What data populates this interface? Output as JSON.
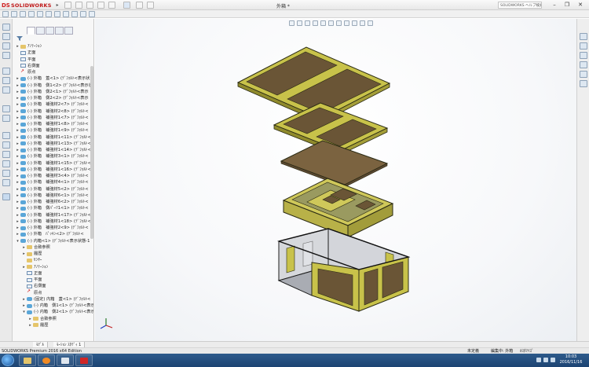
{
  "window": {
    "brand": "SOLIDWORKS",
    "doc_title": "外箱 *",
    "search_text": "SOLIDWORKS ヘルプ検索",
    "min_label": "–",
    "max_label": "❐",
    "close_label": "✕"
  },
  "tree": {
    "rows": [
      {
        "indent": 0,
        "expand": "▸",
        "icon": "folder",
        "label": "ｱﾉﾃｰｼｮﾝ"
      },
      {
        "indent": 0,
        "expand": "",
        "icon": "plane",
        "label": "正面"
      },
      {
        "indent": 0,
        "expand": "",
        "icon": "plane",
        "label": "平面"
      },
      {
        "indent": 0,
        "expand": "",
        "icon": "plane",
        "label": "右側面"
      },
      {
        "indent": 0,
        "expand": "",
        "icon": "origin",
        "label": "原点"
      },
      {
        "indent": 0,
        "expand": "▸",
        "icon": "comp",
        "label": "(-) 外箱　蓋<1> (ﾃﾞﾌｫﾙﾄ<表示状"
      },
      {
        "indent": 0,
        "expand": "▸",
        "icon": "comp",
        "label": "(-) 外箱　側1<2> (ﾃﾞﾌｫﾙﾄ<表示状"
      },
      {
        "indent": 0,
        "expand": "▸",
        "icon": "comp",
        "label": "(-) 外箱　側2<1> (ﾃﾞﾌｫﾙﾄ<表示"
      },
      {
        "indent": 0,
        "expand": "▸",
        "icon": "comp",
        "label": "(-) 外箱　側2<2> (ﾃﾞﾌｫﾙﾄ<表示"
      },
      {
        "indent": 0,
        "expand": "▸",
        "icon": "comp",
        "label": "(-) 外箱　補強材2<7> (ﾃﾞﾌｫﾙﾄ<"
      },
      {
        "indent": 0,
        "expand": "▸",
        "icon": "comp",
        "label": "(-) 外箱　補強材2<8> (ﾃﾞﾌｫﾙﾄ<"
      },
      {
        "indent": 0,
        "expand": "▸",
        "icon": "comp",
        "label": "(-) 外箱　補強材1<7> (ﾃﾞﾌｫﾙﾄ<"
      },
      {
        "indent": 0,
        "expand": "▸",
        "icon": "comp",
        "label": "(-) 外箱　補強材1<8> (ﾃﾞﾌｫﾙﾄ<"
      },
      {
        "indent": 0,
        "expand": "▸",
        "icon": "comp",
        "label": "(-) 外箱　補強材1<9> (ﾃﾞﾌｫﾙﾄ<"
      },
      {
        "indent": 0,
        "expand": "▸",
        "icon": "comp",
        "label": "(-) 外箱　補強材1<11> (ﾃﾞﾌｫﾙﾄ<"
      },
      {
        "indent": 0,
        "expand": "▸",
        "icon": "comp",
        "label": "(-) 外箱　補強材1<13> (ﾃﾞﾌｫﾙﾄ<"
      },
      {
        "indent": 0,
        "expand": "▸",
        "icon": "comp",
        "label": "(-) 外箱　補強材1<14> (ﾃﾞﾌｫﾙﾄ<"
      },
      {
        "indent": 0,
        "expand": "▸",
        "icon": "comp",
        "label": "(-) 外箱　補強材3<1> (ﾃﾞﾌｫﾙﾄ<"
      },
      {
        "indent": 0,
        "expand": "▸",
        "icon": "comp",
        "label": "(-) 外箱　補強材1<15> (ﾃﾞﾌｫﾙﾄ<"
      },
      {
        "indent": 0,
        "expand": "▸",
        "icon": "comp",
        "label": "(-) 外箱　補強材1<16> (ﾃﾞﾌｫﾙﾄ<"
      },
      {
        "indent": 0,
        "expand": "▸",
        "icon": "comp",
        "label": "(-) 外箱　補強材3<4> (ﾃﾞﾌｫﾙﾄ<"
      },
      {
        "indent": 0,
        "expand": "▸",
        "icon": "comp",
        "label": "(-) 外箱　補強材4<1> (ﾃﾞﾌｫﾙﾄ<"
      },
      {
        "indent": 0,
        "expand": "▸",
        "icon": "comp",
        "label": "(-) 外箱　補強材5<2> (ﾃﾞﾌｫﾙﾄ<"
      },
      {
        "indent": 0,
        "expand": "▸",
        "icon": "comp",
        "label": "(-) 外箱　補強材6<1> (ﾃﾞﾌｫﾙﾄ<"
      },
      {
        "indent": 0,
        "expand": "▸",
        "icon": "comp",
        "label": "(-) 外箱　補強材6<2> (ﾃﾞﾌｫﾙﾄ<"
      },
      {
        "indent": 0,
        "expand": "▸",
        "icon": "comp",
        "label": "(-) 外箱　側ﾊﾟｰﾂ1<1> (ﾃﾞﾌｫﾙﾄ<"
      },
      {
        "indent": 0,
        "expand": "▸",
        "icon": "comp",
        "label": "(-) 外箱　補強材1<17> (ﾃﾞﾌｫﾙﾄ<"
      },
      {
        "indent": 0,
        "expand": "▸",
        "icon": "comp",
        "label": "(-) 外箱　補強材1<18> (ﾃﾞﾌｫﾙﾄ<"
      },
      {
        "indent": 0,
        "expand": "▸",
        "icon": "comp",
        "label": "(-) 外箱　補強材2<9> (ﾃﾞﾌｫﾙﾄ<"
      },
      {
        "indent": 0,
        "expand": "▸",
        "icon": "comp",
        "label": "(-) 外箱　ﾊﾟｯｷﾝ<2> (ﾃﾞﾌｫﾙﾄ<"
      },
      {
        "indent": 0,
        "expand": "▾",
        "icon": "comp",
        "label": "(-) 内箱<1> (ﾃﾞﾌｫﾙﾄ<表示状態-1"
      },
      {
        "indent": 1,
        "expand": "▸",
        "icon": "folder",
        "label": "合致参照"
      },
      {
        "indent": 1,
        "expand": "▸",
        "icon": "folder",
        "label": "履歴"
      },
      {
        "indent": 1,
        "expand": "",
        "icon": "folder",
        "label": "ｾﾝｻｰ"
      },
      {
        "indent": 1,
        "expand": "▸",
        "icon": "folder",
        "label": "ｱﾉﾃｰｼｮﾝ"
      },
      {
        "indent": 1,
        "expand": "",
        "icon": "plane",
        "label": "正面"
      },
      {
        "indent": 1,
        "expand": "",
        "icon": "plane",
        "label": "平面"
      },
      {
        "indent": 1,
        "expand": "",
        "icon": "plane",
        "label": "右側面"
      },
      {
        "indent": 1,
        "expand": "",
        "icon": "origin",
        "label": "原点"
      },
      {
        "indent": 1,
        "expand": "▸",
        "icon": "comp",
        "label": "(固定) 内箱　蓋<1> (ﾃﾞﾌｫﾙﾄ<"
      },
      {
        "indent": 1,
        "expand": "▸",
        "icon": "comp",
        "label": "(-) 内箱　側1<1> (ﾃﾞﾌｫﾙﾄ<表示"
      },
      {
        "indent": 1,
        "expand": "▾",
        "icon": "comp",
        "label": "(-) 内箱　側2<1> (ﾃﾞﾌｫﾙﾄ<表示"
      },
      {
        "indent": 2,
        "expand": "▸",
        "icon": "folder",
        "label": "合致参照"
      },
      {
        "indent": 2,
        "expand": "▸",
        "icon": "folder",
        "label": "履歴"
      }
    ]
  },
  "sheet_tabs": [
    "ﾓﾃﾞﾙ",
    "ﾓｰｼｮﾝ ｽﾀﾃﾞｨ 1"
  ],
  "status": {
    "left": "SOLIDWORKS Premium 2016 x64 Edition",
    "under_defined": "未定義",
    "editing": "編集中: 外箱",
    "custom": "ｶｽﾀﾏｲｽﾞ"
  },
  "clock": {
    "time": "10:03",
    "date": "2016/11/16"
  },
  "colors": {
    "frame_olive": "#c8c24a",
    "panel_brown": "#6a5536",
    "inner_grey": "#d6d8dc",
    "taskbar": "#1d4473"
  }
}
